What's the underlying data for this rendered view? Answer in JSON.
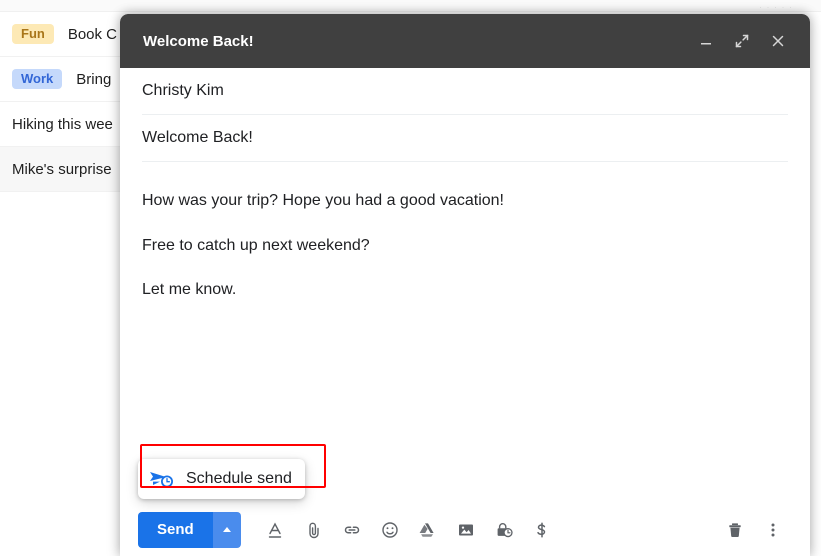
{
  "background": {
    "top_ghost_text": "· · · · ·",
    "rows": [
      {
        "chip": "Fun",
        "chip_type": "fun",
        "text": "Book C"
      },
      {
        "chip": "Work",
        "chip_type": "work",
        "text": "Bring"
      },
      {
        "chip": "",
        "chip_type": "",
        "text": "Hiking this wee"
      },
      {
        "chip": "",
        "chip_type": "",
        "text": "Mike's surprise"
      }
    ]
  },
  "compose": {
    "title": "Welcome Back!",
    "window_controls": {
      "minimize": "minimize-icon",
      "expand": "expand-icon",
      "close": "close-icon"
    },
    "recipient": "Christy Kim",
    "subject": "Welcome Back!",
    "body": [
      "How was your trip? Hope you had a good vacation!",
      "Free to catch up next weekend?",
      "Let me know."
    ],
    "tooltip": {
      "label": "Schedule send",
      "icon": "schedule-send-icon",
      "highlight_color": "#ff0000"
    },
    "toolbar": {
      "send_label": "Send",
      "send_color": "#1a73e8",
      "send_dropdown_icon": "caret-up-icon",
      "items": [
        {
          "name": "formatting-options-icon",
          "title": "Formatting options"
        },
        {
          "name": "attach-file-icon",
          "title": "Attach files"
        },
        {
          "name": "insert-link-icon",
          "title": "Insert link"
        },
        {
          "name": "insert-emoji-icon",
          "title": "Insert emoji"
        },
        {
          "name": "insert-drive-icon",
          "title": "Insert files using Drive"
        },
        {
          "name": "insert-photo-icon",
          "title": "Insert photo"
        },
        {
          "name": "confidential-mode-icon",
          "title": "Toggle confidential mode"
        },
        {
          "name": "insert-money-icon",
          "title": "Insert money"
        }
      ],
      "right_items": [
        {
          "name": "discard-draft-icon",
          "title": "Discard draft"
        },
        {
          "name": "more-options-icon",
          "title": "More options"
        }
      ]
    }
  }
}
